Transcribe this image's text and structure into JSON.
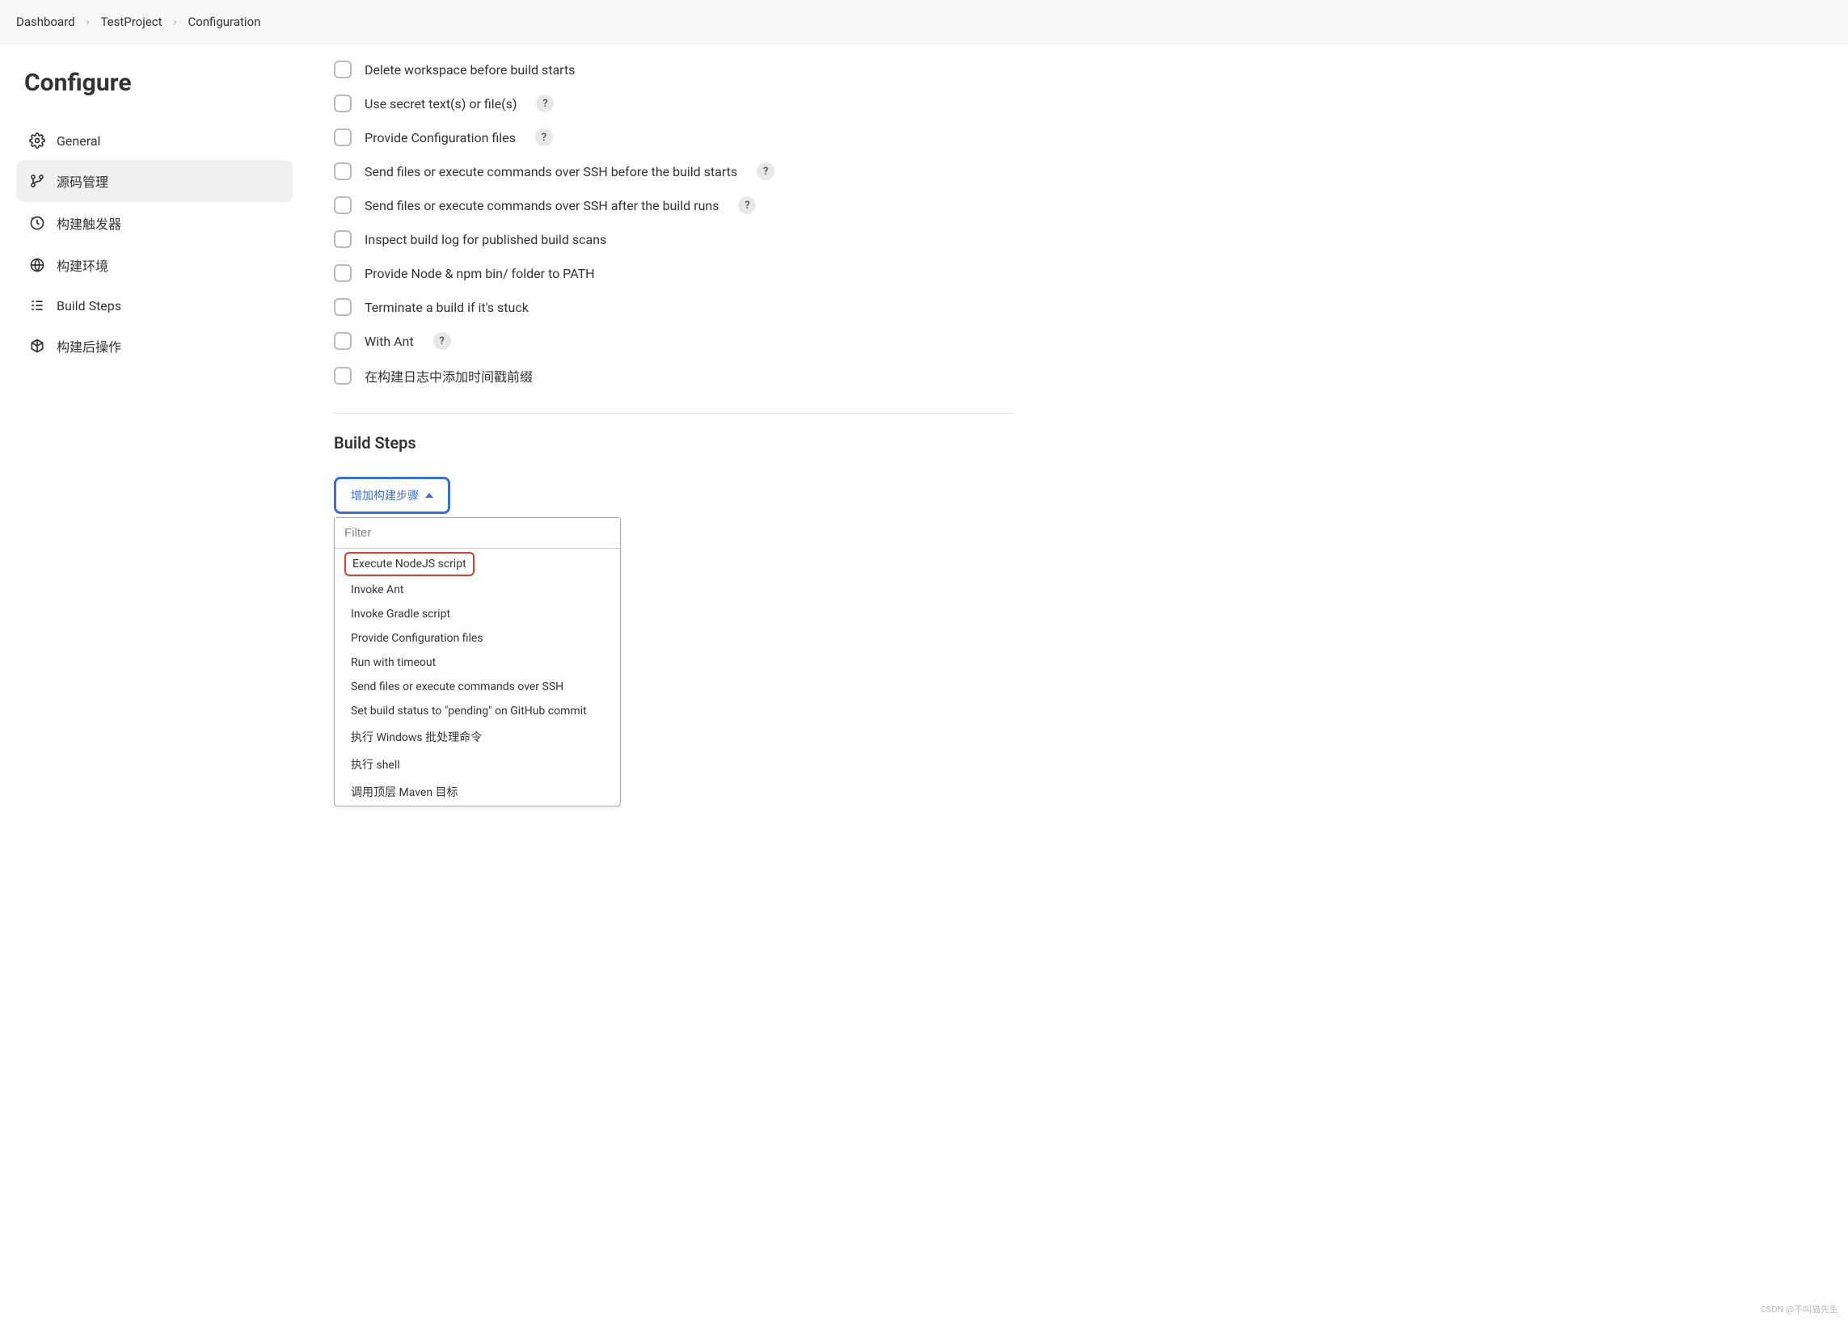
{
  "breadcrumb": {
    "items": [
      "Dashboard",
      "TestProject",
      "Configuration"
    ]
  },
  "page_title": "Configure",
  "sidebar": {
    "items": [
      {
        "label": "General",
        "icon": "gear"
      },
      {
        "label": "源码管理",
        "icon": "branch"
      },
      {
        "label": "构建触发器",
        "icon": "clock"
      },
      {
        "label": "构建环境",
        "icon": "globe"
      },
      {
        "label": "Build Steps",
        "icon": "steps"
      },
      {
        "label": "构建后操作",
        "icon": "package"
      }
    ]
  },
  "build_env": {
    "options": [
      {
        "label": "Delete workspace before build starts",
        "help": false
      },
      {
        "label": "Use secret text(s) or file(s)",
        "help": true
      },
      {
        "label": "Provide Configuration files",
        "help": true
      },
      {
        "label": "Send files or execute commands over SSH before the build starts",
        "help": true
      },
      {
        "label": "Send files or execute commands over SSH after the build runs",
        "help": true
      },
      {
        "label": "Inspect build log for published build scans",
        "help": false
      },
      {
        "label": "Provide Node & npm bin/ folder to PATH",
        "help": false
      },
      {
        "label": "Terminate a build if it's stuck",
        "help": false
      },
      {
        "label": "With Ant",
        "help": true
      },
      {
        "label": "在构建日志中添加时间戳前缀",
        "help": false
      }
    ]
  },
  "build_steps": {
    "heading": "Build Steps",
    "add_button": "增加构建步骤",
    "filter_placeholder": "Filter",
    "options": [
      "Execute NodeJS script",
      "Invoke Ant",
      "Invoke Gradle script",
      "Provide Configuration files",
      "Run with timeout",
      "Send files or execute commands over SSH",
      "Set build status to \"pending\" on GitHub commit",
      "执行 Windows 批处理命令",
      "执行 shell",
      "调用顶层 Maven 目标"
    ]
  },
  "help_symbol": "?",
  "watermark": "CSDN @不叫猫先生"
}
